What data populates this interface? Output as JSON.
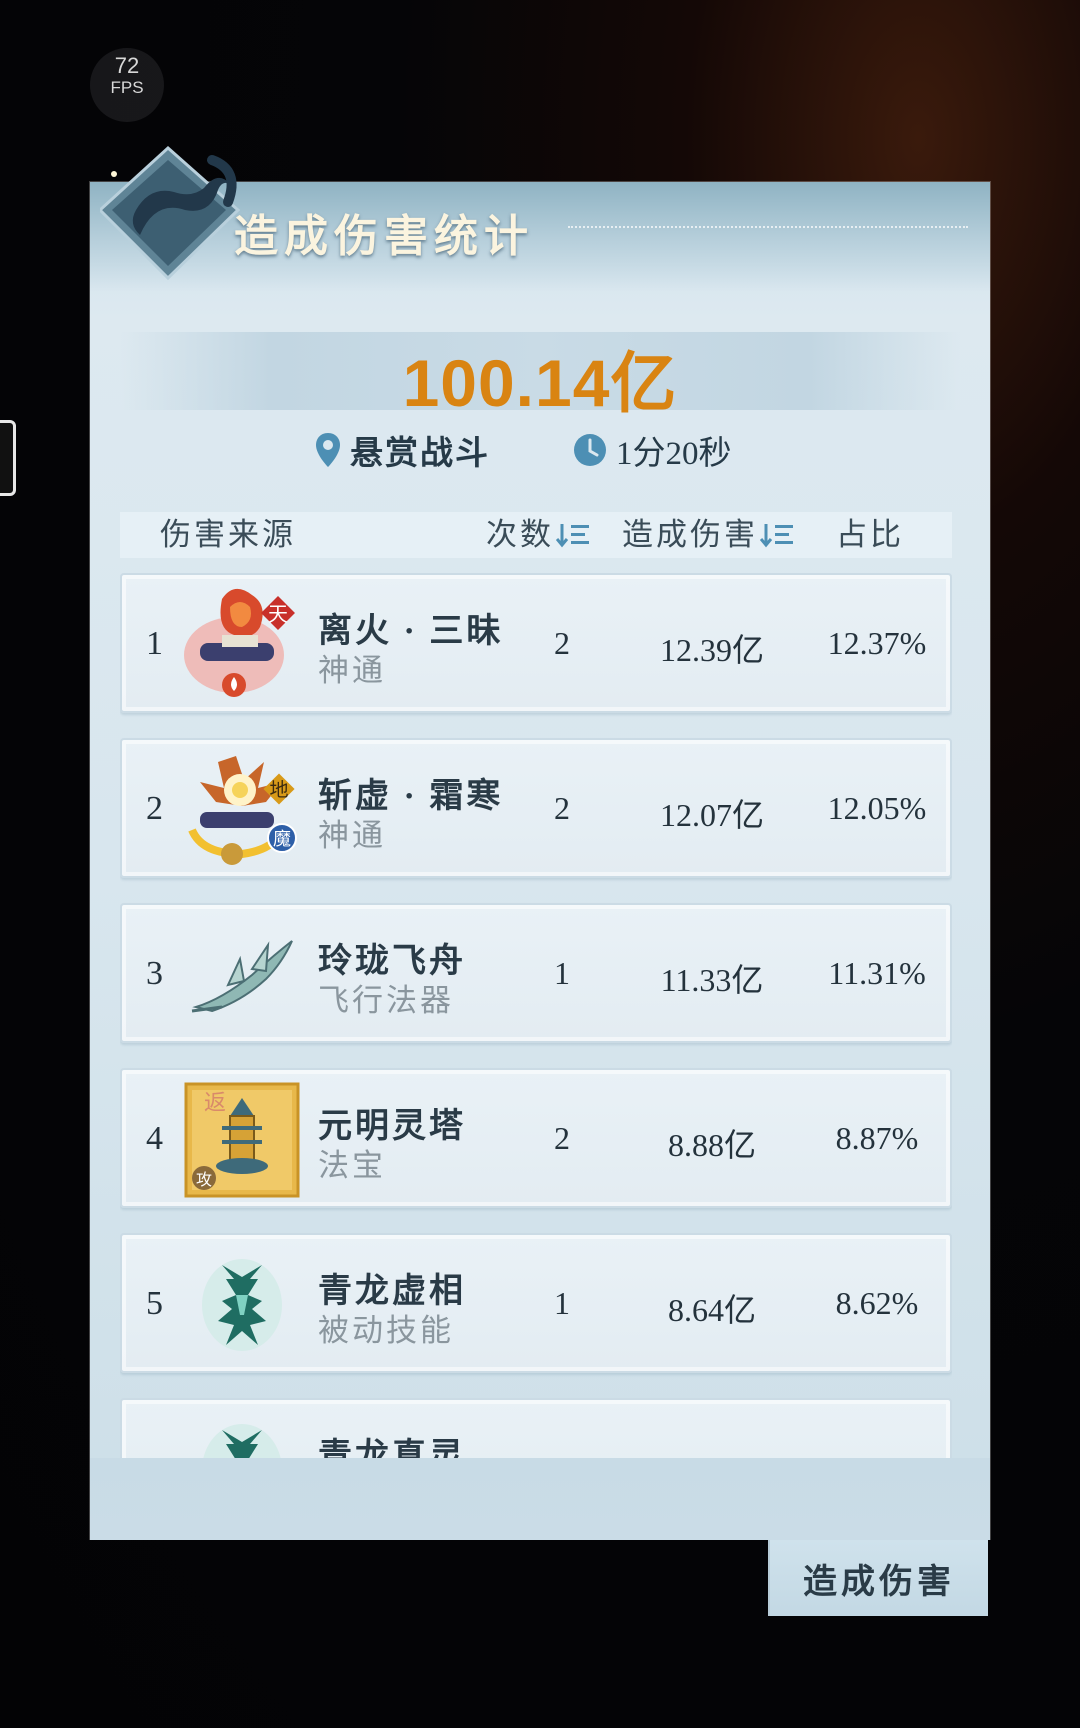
{
  "overlay": {
    "fps_value": "72",
    "fps_unit": "FPS"
  },
  "panel": {
    "title": "造成伤害统计",
    "total_damage": "100.14亿",
    "location_label": "悬赏战斗",
    "duration_label": "1分20秒"
  },
  "table": {
    "headers": {
      "source": "伤害来源",
      "count": "次数",
      "damage": "造成伤害",
      "ratio": "占比"
    },
    "rows": [
      {
        "rank": "1",
        "name": "离火 · 三昧",
        "type": "神通",
        "count": "2",
        "damage": "12.39亿",
        "ratio": "12.37%",
        "icon": "fire-scroll-icon",
        "badge": "天"
      },
      {
        "rank": "2",
        "name": "斩虚 · 霜寒",
        "type": "神通",
        "count": "2",
        "damage": "12.07亿",
        "ratio": "12.05%",
        "icon": "lotus-scroll-icon",
        "badge": "地",
        "badge2": "魔"
      },
      {
        "rank": "3",
        "name": "玲珑飞舟",
        "type": "飞行法器",
        "count": "1",
        "damage": "11.33亿",
        "ratio": "11.31%",
        "icon": "flying-boat-icon"
      },
      {
        "rank": "4",
        "name": "元明灵塔",
        "type": "法宝",
        "count": "2",
        "damage": "8.88亿",
        "ratio": "8.87%",
        "icon": "spirit-pagoda-icon",
        "badge": "攻",
        "corner": "返"
      },
      {
        "rank": "5",
        "name": "青龙虚相",
        "type": "被动技能",
        "count": "1",
        "damage": "8.64亿",
        "ratio": "8.62%",
        "icon": "azure-dragon-icon"
      },
      {
        "rank": "",
        "name": "青龙真灵",
        "type": "",
        "count": "",
        "damage": "",
        "ratio": "",
        "icon": "azure-dragon-icon"
      }
    ]
  },
  "bottom_tab": {
    "label": "造成伤害"
  },
  "colors": {
    "accent_total": "#d98412",
    "panel_bg": "#d8e6ee",
    "text_dark": "#2a3b47",
    "text_muted": "#8a969e"
  }
}
